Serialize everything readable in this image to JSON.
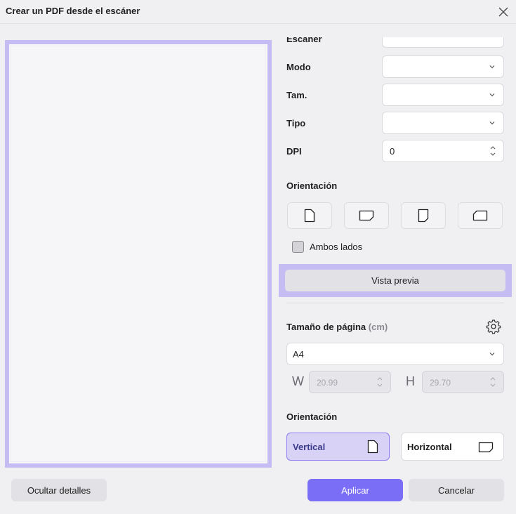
{
  "window": {
    "title": "Crear un PDF desde el escáner"
  },
  "scanner": {
    "partial_label": "Escáner",
    "mode_label": "Modo",
    "mode_value": "",
    "size_label": "Tam.",
    "size_value": "",
    "type_label": "Tipo",
    "type_value": "",
    "dpi_label": "DPI",
    "dpi_value": "0",
    "orientation_label": "Orientación",
    "both_sides_label": "Ambos lados",
    "both_sides_checked": false,
    "preview_button": "Vista previa"
  },
  "page": {
    "size_label": "Tamaño de página",
    "size_unit": "(cm)",
    "size_value": "A4",
    "width_letter": "W",
    "width_value": "20.99",
    "height_letter": "H",
    "height_value": "29.70",
    "orientation_label": "Orientación",
    "vertical_label": "Vertical",
    "horizontal_label": "Horizontal",
    "selected_orientation": "Vertical"
  },
  "footer": {
    "hide_details": "Ocultar detalles",
    "apply": "Aplicar",
    "cancel": "Cancelar"
  },
  "colors": {
    "accent": "#7b6ef6",
    "highlight": "#c4bcf3",
    "selected_bg": "#d8d3f6"
  },
  "icons": [
    "close-icon",
    "chevron-down-icon",
    "spinner-arrows-icon",
    "portrait-page-icon",
    "landscape-page-icon",
    "gear-icon"
  ]
}
